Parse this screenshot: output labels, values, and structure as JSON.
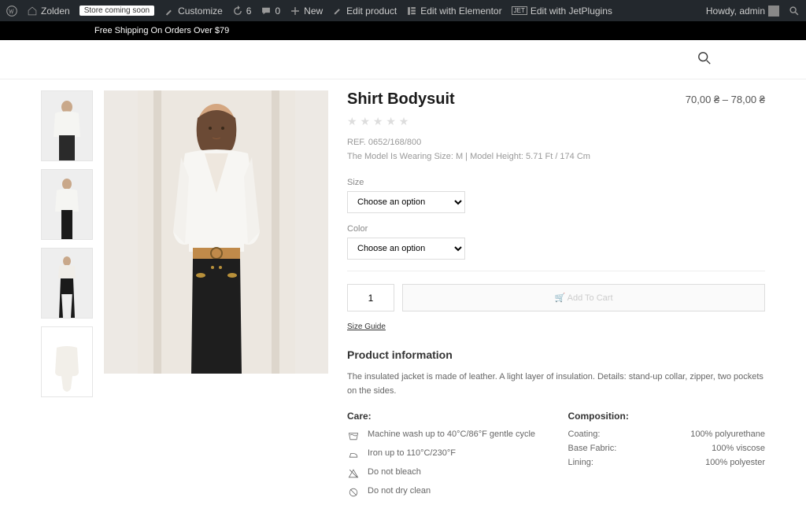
{
  "adminbar": {
    "site": "Zolden",
    "store_badge": "Store coming soon",
    "customize": "Customize",
    "updates": "6",
    "comments": "0",
    "new": "New",
    "edit_product": "Edit product",
    "edit_elementor": "Edit with Elementor",
    "edit_jetplugins": "Edit with JetPlugins",
    "howdy": "Howdy, admin"
  },
  "promo": "Free Shipping On Orders Over $79",
  "product": {
    "title": "Shirt Bodysuit",
    "price": "70,00 ₴ – 78,00 ₴",
    "ref": "REF. 0652/168/800",
    "model": "The Model Is Wearing Size: M | Model Height: 5.71 Ft / 174 Cm",
    "size_label": "Size",
    "size_option": "Choose an option",
    "color_label": "Color",
    "color_option": "Choose an option",
    "qty": "1",
    "add_cart": "🛒 Add To Cart",
    "size_guide": "Size Guide",
    "info_title": "Product information",
    "desc": "The insulated jacket is made of leather. A light layer of insulation. Details: stand-up collar, zipper, two pockets on the sides.",
    "care_head": "Care:",
    "care": [
      "Machine wash up to 40°C/86°F gentle cycle",
      "Iron up to 110°C/230°F",
      "Do not bleach",
      "Do not dry clean"
    ],
    "comp_head": "Composition:",
    "comp": [
      {
        "k": "Coating:",
        "v": "100% polyurethane"
      },
      {
        "k": "Base Fabric:",
        "v": "100% viscose"
      },
      {
        "k": "Lining:",
        "v": "100% polyester"
      }
    ]
  }
}
